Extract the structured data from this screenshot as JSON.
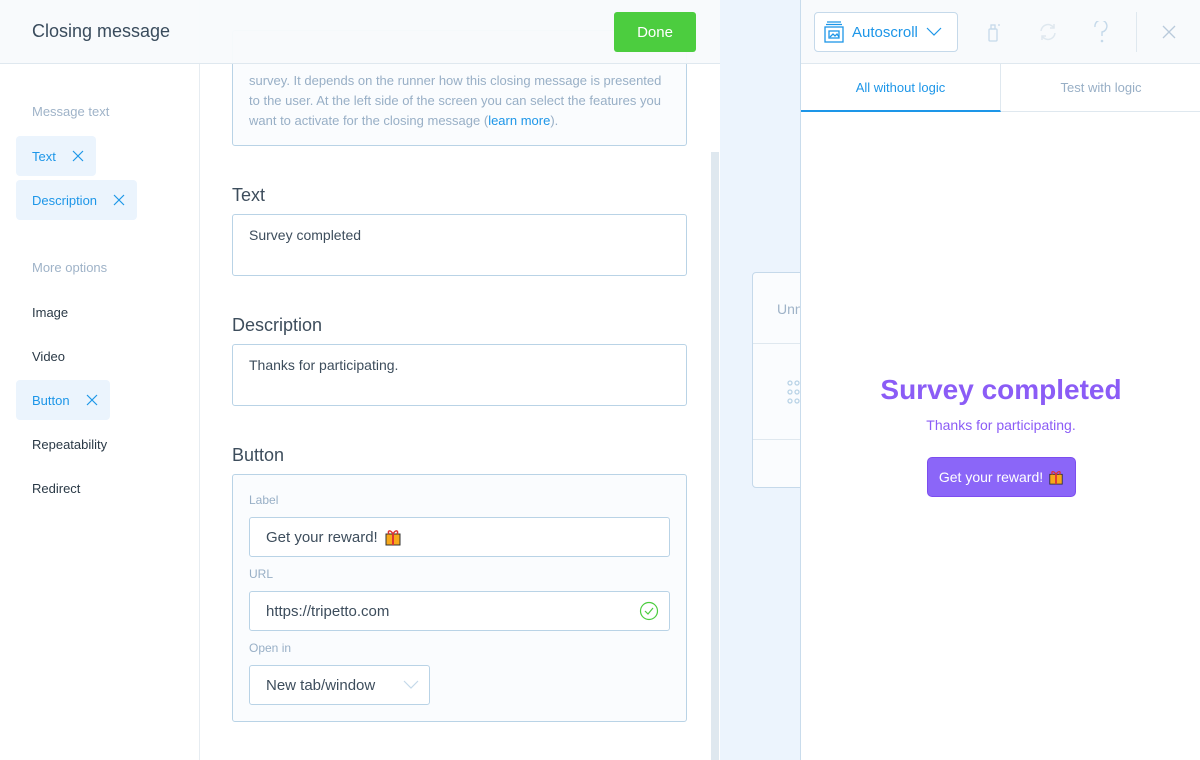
{
  "header": {
    "title": "Closing message",
    "done_label": "Done"
  },
  "sidebar": {
    "message_text_label": "Message text",
    "active": [
      {
        "label": "Text"
      },
      {
        "label": "Description"
      }
    ],
    "more_options_label": "More options",
    "options": [
      {
        "label": "Image"
      },
      {
        "label": "Video"
      },
      {
        "label": "Button",
        "active": true
      },
      {
        "label": "Repeatability"
      },
      {
        "label": "Redirect"
      }
    ]
  },
  "editor": {
    "explanation_lines": [
      "survey. It depends on the runner how this closing message is presented",
      "to the user. At the left side of the screen you can select the features you",
      "want to activate for the closing message ("
    ],
    "learn_more": "learn more",
    "explanation_end": ").",
    "text_heading": "Text",
    "text_value": "Survey completed",
    "description_heading": "Description",
    "description_value": "Thanks for participating.",
    "button_heading": "Button",
    "label_label": "Label",
    "label_value": "Get your reward!",
    "url_label": "URL",
    "url_value": "https://tripetto.com",
    "open_in_label": "Open in",
    "open_in_value": "New tab/window"
  },
  "preview": {
    "autoscroll_label": "Autoscroll",
    "tabs": [
      {
        "label": "All without logic",
        "active": true
      },
      {
        "label": "Test with logic"
      }
    ],
    "title": "Survey completed",
    "description": "Thanks for participating.",
    "button_label": "Get your reward!",
    "card_text": "Unn"
  },
  "colors": {
    "accent": "#1d96e8",
    "done": "#4ccd3f",
    "preview_purple": "#8b5cf6"
  }
}
